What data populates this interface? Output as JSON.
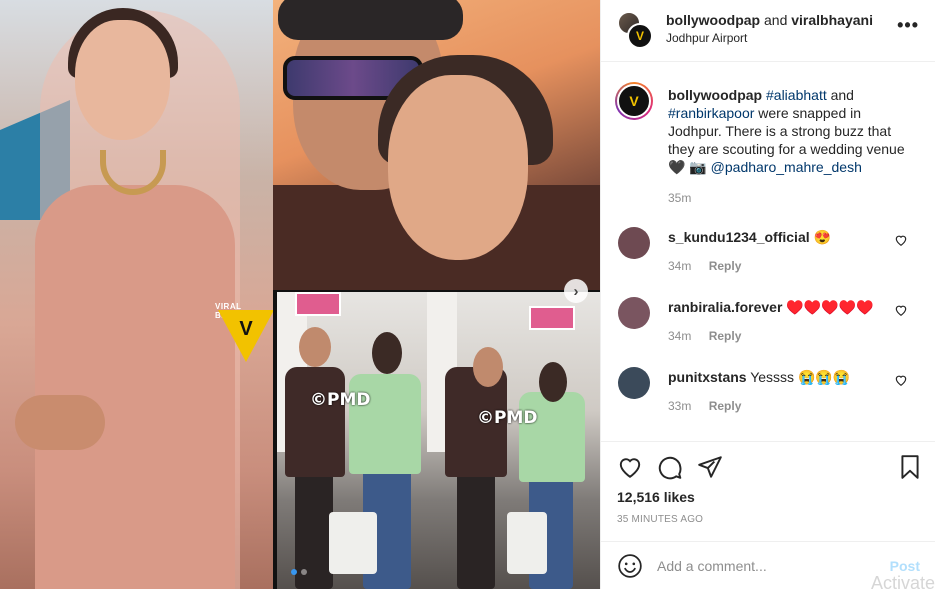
{
  "post": {
    "header": {
      "user1": "bollywoodpap",
      "joiner": "and",
      "user2": "viralbhayani",
      "location": "Jodhpur Airport",
      "more_icon": "more-horizontal-icon"
    },
    "caption": {
      "username": "bollywoodpap",
      "tag1": "#aliabhatt",
      "text1": "and",
      "tag2": "#ranbirkapoor",
      "text2": "were snapped in Jodhpur. There is a strong buzz that they are scouting for a wedding venue",
      "emoji": "🖤 📷",
      "mention": "@padharo_mahre_desh",
      "time": "35m"
    },
    "comments": [
      {
        "username": "s_kundu1234_official",
        "text": "😍",
        "time": "34m",
        "reply_label": "Reply",
        "avatar_color": "#6e4a52"
      },
      {
        "username": "ranbiralia.forever",
        "text": "♥️♥️♥️♥️♥️",
        "time": "34m",
        "reply_label": "Reply",
        "avatar_color": "#7a5560"
      },
      {
        "username": "punitxstans",
        "text": "Yessss 😭😭😭",
        "time": "33m",
        "reply_label": "Reply",
        "avatar_color": "#3b4a5a"
      }
    ],
    "likes": "12,516 likes",
    "posted_ago": "35 MINUTES AGO",
    "add_comment": {
      "placeholder": "Add a comment...",
      "post_label": "Post"
    },
    "media": {
      "watermark_bride": "VIRAL BHAYANI",
      "logo_letter": "V",
      "watermark_airport": "©PMD",
      "next_icon": "chevron-right-icon",
      "slide_count": 2,
      "active_slide": 1
    },
    "overlay_text": "Activate",
    "colors": {
      "link": "#00376b",
      "muted": "#8e8e8e",
      "post_disabled": "#b2dffc",
      "dot_active": "#3897f0",
      "logo_yellow": "#f2c200"
    }
  }
}
